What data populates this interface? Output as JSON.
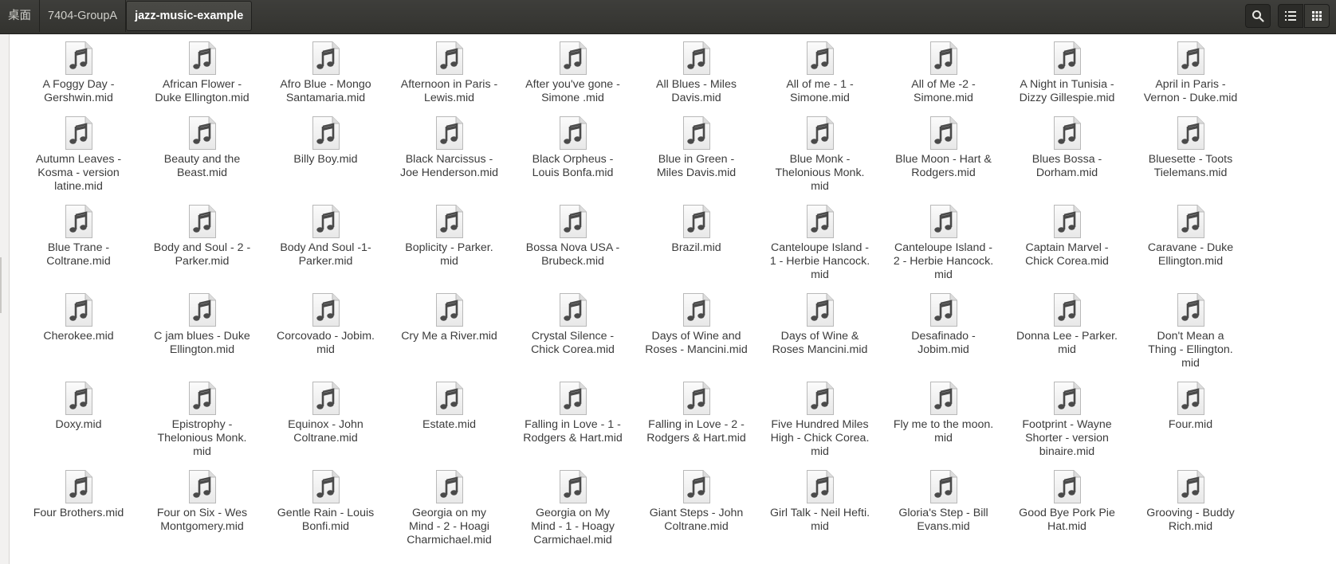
{
  "breadcrumb": [
    "桌面",
    "7404-GroupA",
    "jazz-music-example"
  ],
  "icons": {
    "search": "search-icon",
    "list_view": "list-view-icon",
    "grid_view": "grid-view-icon",
    "file": "music-file-icon"
  },
  "files": [
    "A Foggy Day -\nGershwin.mid",
    "African Flower -\nDuke Ellington.mid",
    "Afro Blue - Mongo\nSantamaria.mid",
    "Afternoon in Paris -\nLewis.mid",
    "After you've gone -\nSimone .mid",
    "All Blues - Miles\nDavis.mid",
    "All of me - 1 -\nSimone.mid",
    "All of Me -2 -\nSimone.mid",
    "A Night in Tunisia -\nDizzy Gillespie.mid",
    "April in Paris -\nVernon - Duke.mid",
    "Autumn Leaves -\nKosma - version\nlatine.mid",
    "Beauty and the\nBeast.mid",
    "Billy Boy.mid",
    "Black Narcissus -\nJoe Henderson.mid",
    "Black Orpheus -\nLouis Bonfa.mid",
    "Blue in Green -\nMiles Davis.mid",
    "Blue Monk -\nThelonious Monk.\nmid",
    "Blue Moon - Hart &\nRodgers.mid",
    "Blues Bossa -\nDorham.mid",
    "Bluesette - Toots\nTielemans.mid",
    "Blue Trane -\nColtrane.mid",
    "Body and Soul - 2 -\nParker.mid",
    "Body And Soul -1-\nParker.mid",
    "Boplicity - Parker.\nmid",
    "Bossa Nova USA -\nBrubeck.mid",
    "Brazil.mid",
    "Canteloupe Island -\n1 - Herbie Hancock.\nmid",
    "Canteloupe Island -\n2 - Herbie Hancock.\nmid",
    "Captain Marvel -\nChick Corea.mid",
    "Caravane - Duke\nEllington.mid",
    "Cherokee.mid",
    "C jam blues - Duke\nEllington.mid",
    "Corcovado - Jobim.\nmid",
    "Cry Me a River.mid",
    "Crystal Silence -\nChick Corea.mid",
    "Days of Wine and\nRoses - Mancini.mid",
    "Days of Wine &\nRoses  Mancini.mid",
    "Desafinado -\nJobim.mid",
    "Donna Lee - Parker.\nmid",
    "Don't Mean a\nThing - Ellington.\nmid",
    "Doxy.mid",
    "Epistrophy -\nThelonious Monk.\nmid",
    "Equinox - John\nColtrane.mid",
    "Estate.mid",
    "Falling in Love - 1 -\nRodgers & Hart.mid",
    "Falling in Love - 2 -\nRodgers & Hart.mid",
    "Five Hundred Miles\nHigh - Chick Corea.\nmid",
    "Fly me to the moon.\nmid",
    "Footprint - Wayne\nShorter - version\nbinaire.mid",
    "Four.mid",
    "Four Brothers.mid",
    "Four on Six - Wes\nMontgomery.mid",
    "Gentle Rain - Louis\nBonfi.mid",
    "Georgia on my\nMind - 2 - Hoagi\nCharmichael.mid",
    "Georgia on My\nMind - 1 - Hoagy\nCarmichael.mid",
    "Giant Steps - John\nColtrane.mid",
    "Girl Talk - Neil Hefti.\nmid",
    "Gloria's Step - Bill\nEvans.mid",
    "Good Bye Pork Pie\nHat.mid",
    "Grooving - Buddy\nRich.mid"
  ]
}
